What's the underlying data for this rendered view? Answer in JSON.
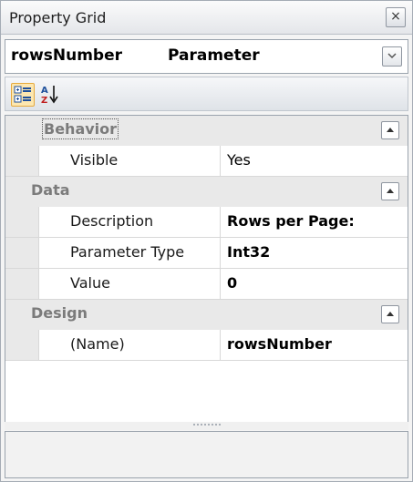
{
  "window": {
    "title": "Property Grid",
    "close_glyph": "×"
  },
  "selector": {
    "object_name": "rowsNumber",
    "object_type": "Parameter",
    "dropdown_glyph": "⌄"
  },
  "toolbar": {
    "categorized_icon": "categorized-view-icon",
    "alphabetical_icon": "sort-alphabetical-icon"
  },
  "grid": {
    "categories": [
      {
        "label": "Behavior",
        "focused": true,
        "rows": [
          {
            "name": "Visible",
            "value": "Yes",
            "bold": false
          }
        ]
      },
      {
        "label": "Data",
        "focused": false,
        "rows": [
          {
            "name": "Description",
            "value": "Rows per Page:",
            "bold": true
          },
          {
            "name": "Parameter Type",
            "value": "Int32",
            "bold": true
          },
          {
            "name": "Value",
            "value": "0",
            "bold": true
          }
        ]
      },
      {
        "label": "Design",
        "focused": false,
        "rows": [
          {
            "name": "(Name)",
            "value": "rowsNumber",
            "bold": true
          }
        ]
      }
    ]
  },
  "colors": {
    "category_bg": "#e9e9e9",
    "category_text": "#7b7b7b",
    "accent_button": "#fde7b0"
  }
}
